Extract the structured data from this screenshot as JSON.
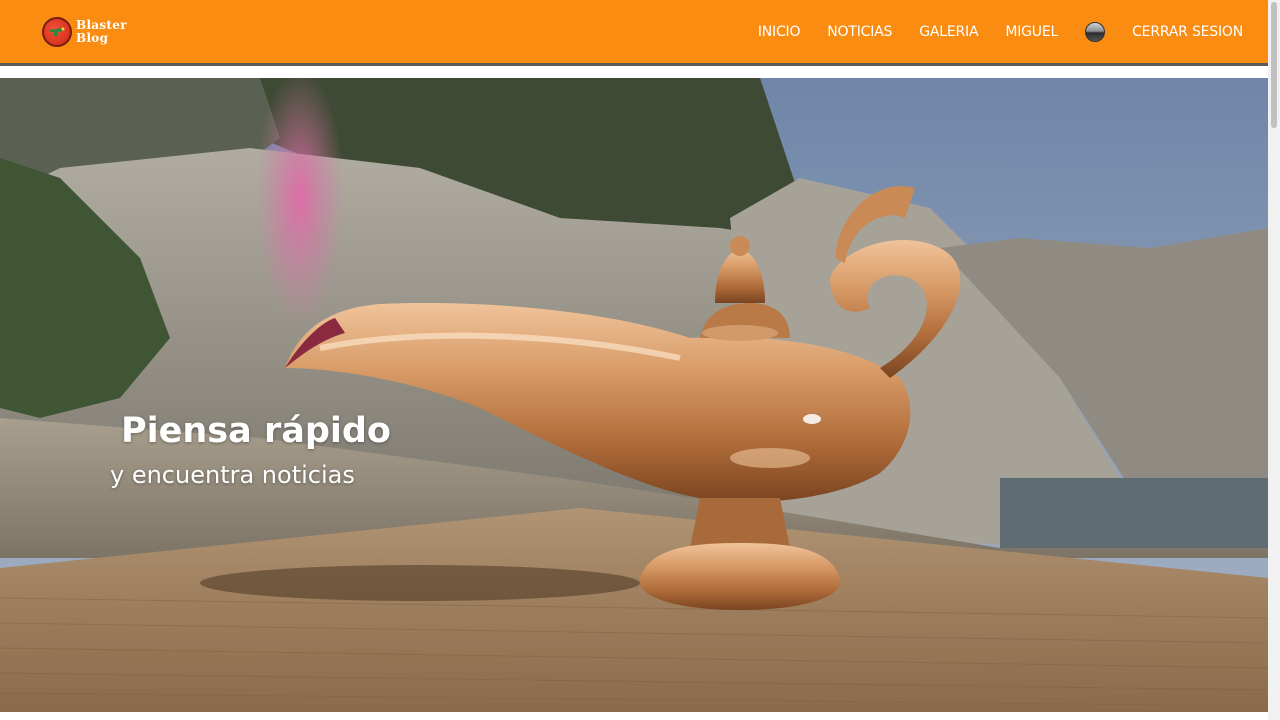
{
  "brand": {
    "line1": "Blaster",
    "line2": "Blog",
    "logo_icon": "ray-gun-logo-icon"
  },
  "nav": {
    "items": [
      {
        "label": "INICIO"
      },
      {
        "label": "NOTICIAS"
      },
      {
        "label": "GALERIA"
      },
      {
        "label": "MIGUEL"
      }
    ],
    "avatar_icon": "user-avatar-icon",
    "logout_label": "CERRAR SESION"
  },
  "hero": {
    "title": "Piensa rápido",
    "subtitle": "y encuentra noticias",
    "image_subject": "golden magic lamp on wooden table with rocky beach background"
  },
  "colors": {
    "navbar": "#fb8c12",
    "navbar_border": "#5a5a5a",
    "text_light": "#ffffff"
  }
}
